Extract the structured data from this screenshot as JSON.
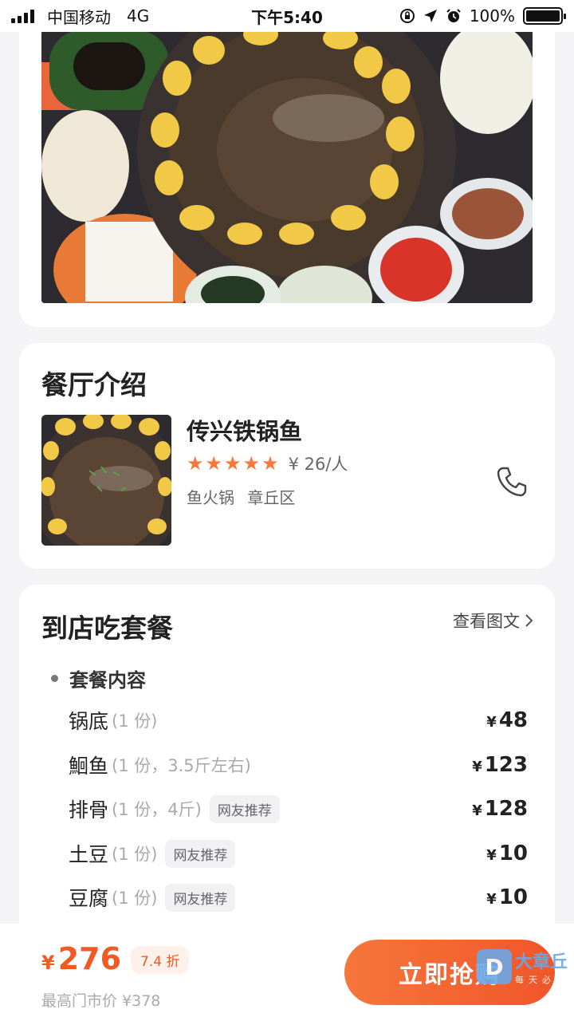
{
  "status_bar": {
    "carrier": "中国移动",
    "network": "4G",
    "time": "下午5:40",
    "battery_percent": "100%",
    "battery_level": 1.0
  },
  "intro": {
    "title": "餐厅介绍",
    "restaurant_name": "传兴铁锅鱼",
    "rating_stars": 5,
    "price_per_person": "¥ 26/人",
    "tags": [
      "鱼火锅",
      "章丘区"
    ],
    "phone_icon": "phone-icon"
  },
  "package": {
    "title": "到店吃套餐",
    "view_more": "查看图文",
    "section_label": "套餐内容",
    "items": [
      {
        "name": "锅底",
        "detail": "(1 份)",
        "tag": "",
        "currency": "¥",
        "price": "48"
      },
      {
        "name": "鮰鱼",
        "detail": "(1 份，3.5斤左右)",
        "tag": "",
        "currency": "¥",
        "price": "123"
      },
      {
        "name": "排骨",
        "detail": "(1 份，4斤)",
        "tag": "网友推荐",
        "currency": "¥",
        "price": "128"
      },
      {
        "name": "土豆",
        "detail": "(1 份)",
        "tag": "网友推荐",
        "currency": "¥",
        "price": "10"
      },
      {
        "name": "豆腐",
        "detail": "(1 份)",
        "tag": "网友推荐",
        "currency": "¥",
        "price": "10"
      }
    ]
  },
  "bottom_bar": {
    "currency": "¥",
    "total": "276",
    "discount": "7.4 折",
    "original_price": "最高门市价 ¥378",
    "buy_label": "立即抢购"
  },
  "watermark": {
    "logo": "D",
    "main": "大章丘",
    "sub": "每天必"
  },
  "colors": {
    "accent": "#f05a24",
    "star": "#f5793b",
    "button_start": "#f7763b",
    "button_end": "#f0562a"
  }
}
